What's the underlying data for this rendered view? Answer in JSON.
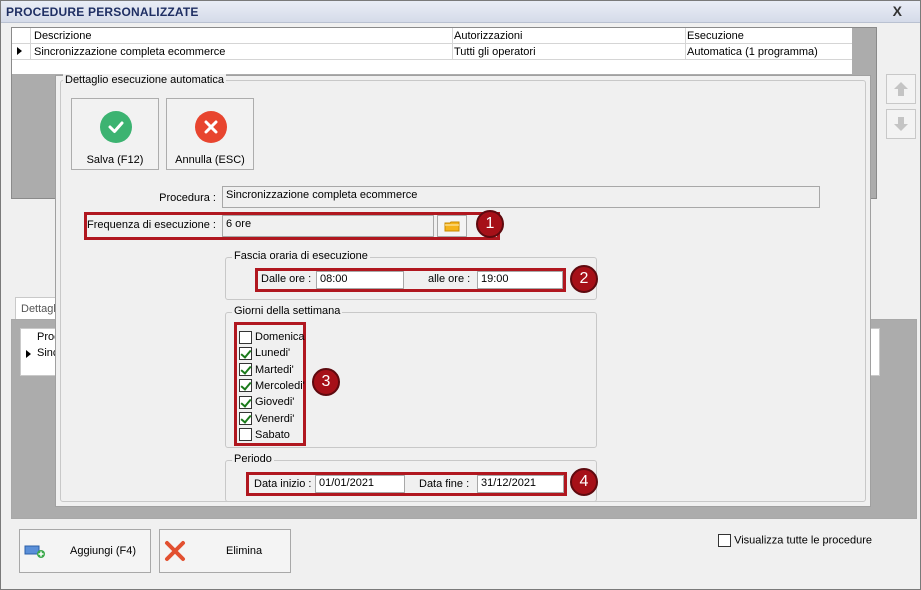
{
  "window": {
    "title": "PROCEDURE PERSONALIZZATE",
    "close_glyph": "X"
  },
  "main_grid": {
    "columns": [
      "Descrizione",
      "Autorizzazioni",
      "Esecuzione"
    ],
    "rows": [
      {
        "descrizione": "Sincronizzazione completa ecommerce",
        "autorizzazioni": "Tutti gli operatori",
        "esecuzione": "Automatica (1 programma)"
      }
    ]
  },
  "lower_section": {
    "tab_label": "Dettaglio",
    "grid_header": "Proc",
    "grid_row": "Sincr"
  },
  "dialog": {
    "legend": "Dettaglio esecuzione automatica",
    "save_label": "Salva (F12)",
    "cancel_label": "Annulla (ESC)",
    "procedura_label": "Procedura :",
    "procedura_value": "Sincronizzazione completa ecommerce",
    "frequenza_label": "Frequenza di esecuzione :",
    "frequenza_value": "6 ore",
    "fascia": {
      "title": "Fascia oraria di esecuzione",
      "from_label": "Dalle ore :",
      "from_value": "08:00",
      "to_label": "alle ore :",
      "to_value": "19:00"
    },
    "giorni": {
      "title": "Giorni della settimana",
      "days": [
        {
          "label": "Domenica",
          "checked": false
        },
        {
          "label": "Lunedi'",
          "checked": true
        },
        {
          "label": "Martedi'",
          "checked": true
        },
        {
          "label": "Mercoledi'",
          "checked": true
        },
        {
          "label": "Giovedi'",
          "checked": true
        },
        {
          "label": "Venerdi'",
          "checked": true
        },
        {
          "label": "Sabato",
          "checked": false
        }
      ]
    },
    "periodo": {
      "title": "Periodo",
      "start_label": "Data inizio :",
      "start_value": "01/01/2021",
      "end_label": "Data fine :",
      "end_value": "31/12/2021"
    },
    "badges": [
      "1",
      "2",
      "3",
      "4"
    ]
  },
  "bottom": {
    "add_label": "Aggiungi (F4)",
    "delete_label": "Elimina",
    "show_all_label": "Visualizza tutte le procedure"
  },
  "colors": {
    "highlight": "#b0171f",
    "badge": "#a61018",
    "save_green": "#3cb371",
    "cancel_red": "#e8452f"
  }
}
